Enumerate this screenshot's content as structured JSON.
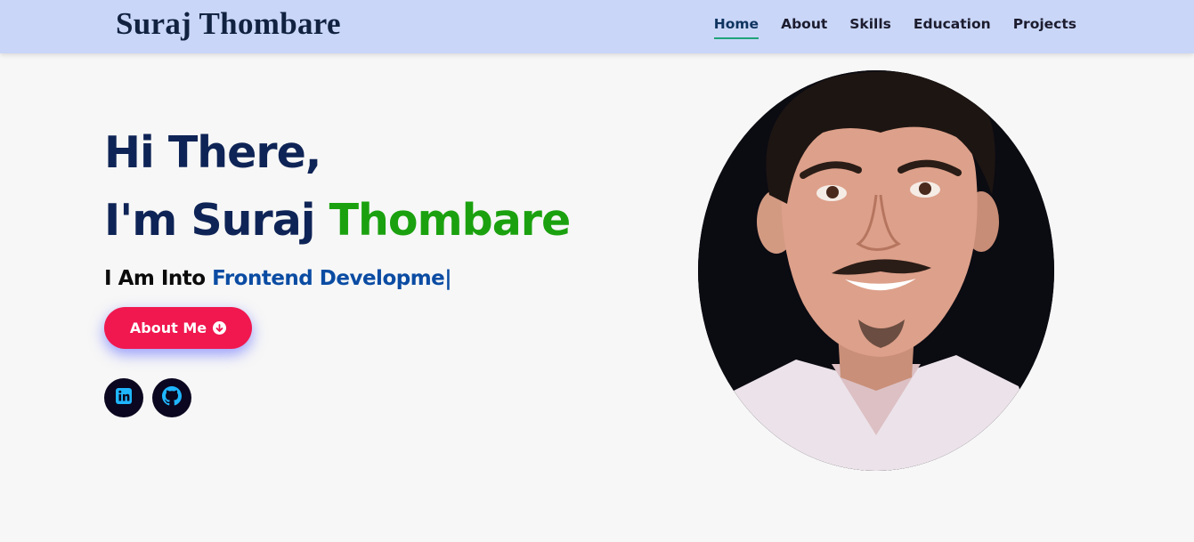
{
  "header": {
    "brand": "Suraj Thombare",
    "nav": [
      {
        "label": "Home",
        "active": true
      },
      {
        "label": "About",
        "active": false
      },
      {
        "label": "Skills",
        "active": false
      },
      {
        "label": "Education",
        "active": false
      },
      {
        "label": "Projects",
        "active": false
      }
    ]
  },
  "hero": {
    "greeting_line1": "Hi There,",
    "greeting_prefix": "I'm Suraj ",
    "greeting_accent": "Thombare",
    "into_prefix": "I Am Into ",
    "typed_text": "Frontend Developme",
    "cursor": "|",
    "cta_label": "About Me",
    "cta_icon": "arrow-circle-down-icon",
    "socials": [
      {
        "name": "linkedin-icon"
      },
      {
        "name": "github-icon"
      }
    ],
    "photo": "profile-photo"
  },
  "colors": {
    "navbar_bg": "#c9d6f8",
    "heading": "#0f2456",
    "accent_green": "#1ba10f",
    "typed_blue": "#0b4ca3",
    "button": "#f0184f",
    "social_bg": "#0b0720",
    "social_icon": "#1fb6ff",
    "active_underline": "#20a37a"
  }
}
